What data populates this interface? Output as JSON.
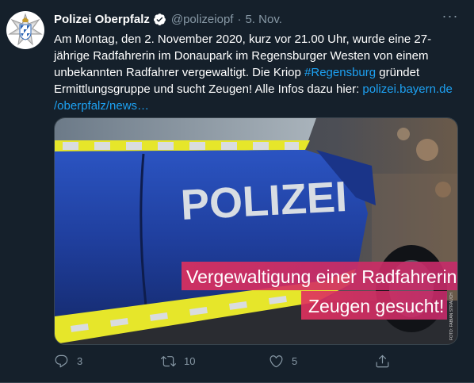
{
  "tweet": {
    "author_name": "Polizei Oberpfalz",
    "handle": "@polizeiopf",
    "separator": "·",
    "date": "5. Nov.",
    "more_label": "···",
    "text_part1": "Am Montag, den 2. November 2020, kurz vor 21.00 Uhr, wurde eine 27-jährige Radfahrerin im Donaupark im Regensburger Westen von einem unbekannten Radfahrer vergewaltigt. Die Kriop ",
    "hashtag": "#Regensburg",
    "text_part2": " gründet Ermittlungsgruppe und sucht Zeugen! Alle Infos dazu hier: ",
    "link": "polizei.bayern.de/oberpfalz/news…",
    "link_line1": "polizei.bayern.de",
    "link_line2": "/oberpfalz/news…"
  },
  "media": {
    "car_lettering": "POLIZEI",
    "overlay_line1": "Vergewaltigung einer Radfahrerin",
    "overlay_line2": "Zeugen gesucht!",
    "photo_credit": "FOTO: FABIAN STRAUCH"
  },
  "actions": {
    "reply_count": "3",
    "retweet_count": "10",
    "like_count": "5"
  },
  "colors": {
    "background": "#15202b",
    "text": "#ffffff",
    "secondary_text": "#8899a6",
    "link": "#1da1f2",
    "police_blue": "#1f3e9c",
    "police_yellow": "#e6e62a",
    "overlay_pink": "#e0305e"
  },
  "icons": [
    "police-star-avatar-icon",
    "verified-icon",
    "more-icon",
    "reply-icon",
    "retweet-icon",
    "like-icon",
    "share-icon"
  ]
}
